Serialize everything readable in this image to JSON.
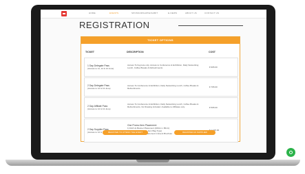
{
  "nav": {
    "items": [
      "HOME",
      "EVENTS",
      "SPONSORSHIP/EXHIBIT",
      "E-NEWS",
      "ABOUT US",
      "CONTACT US"
    ],
    "active_index": 1
  },
  "page": {
    "title": "REGISTRATION"
  },
  "ticket_table": {
    "header": "TICKET OPTIONS",
    "columns": {
      "ticket": "TICKET",
      "description": "DESCRIPTION",
      "cost": "COST"
    },
    "rows": [
      {
        "name": "1 Day Delegate Pass",
        "date": "(Access to 11, 12 & 13 June)",
        "description": "Access To Keynote only, Access to Conference & Exhibition, Daily Networking Lunch, Coffee Breaks & Refreshments",
        "cost": "€ 995.00"
      },
      {
        "name": "2 Day Delegate Pass",
        "date": "(Access to 12 & 13 June)",
        "description": "Access To Conference & Exhibition, Daily Networking Lunch, Coffee Breaks & Refreshments",
        "cost": "€ 795.00"
      },
      {
        "name": "2 Day Affiliate Pass",
        "date": "(Access to 12 & 13 June)",
        "description": "Access To Conference & Exhibition, Daily Networking Lunch, Coffee Breaks & Refreshments, No Drawing included. Available to Affiliates only",
        "cost": "€ 595.00"
      },
      {
        "name": "2 Day Supplier Pass",
        "date": "(Access to 12 & 13 June)",
        "description": "One Promo Item Placement:",
        "extras": [
          "1) Roll Up Banner Placement (200cm x 80cm)",
          "2) Cowgate (Cordless Item Bag Type)",
          "3) Full Page Advert Placement in Event Brochure"
        ],
        "cost": "€ 1 195.00"
      }
    ],
    "buttons": [
      "REGISTER TO ATTEND THE EVENT",
      "REGISTER AS SUPPLIER"
    ]
  },
  "colors": {
    "accent": "#f5a02a",
    "nav_active": "#f0961e",
    "logo": "#e53935",
    "chat": "#2bb34a"
  },
  "icons": {
    "logo": "brand-logo-icon",
    "chat": "whatsapp-chat-icon"
  }
}
